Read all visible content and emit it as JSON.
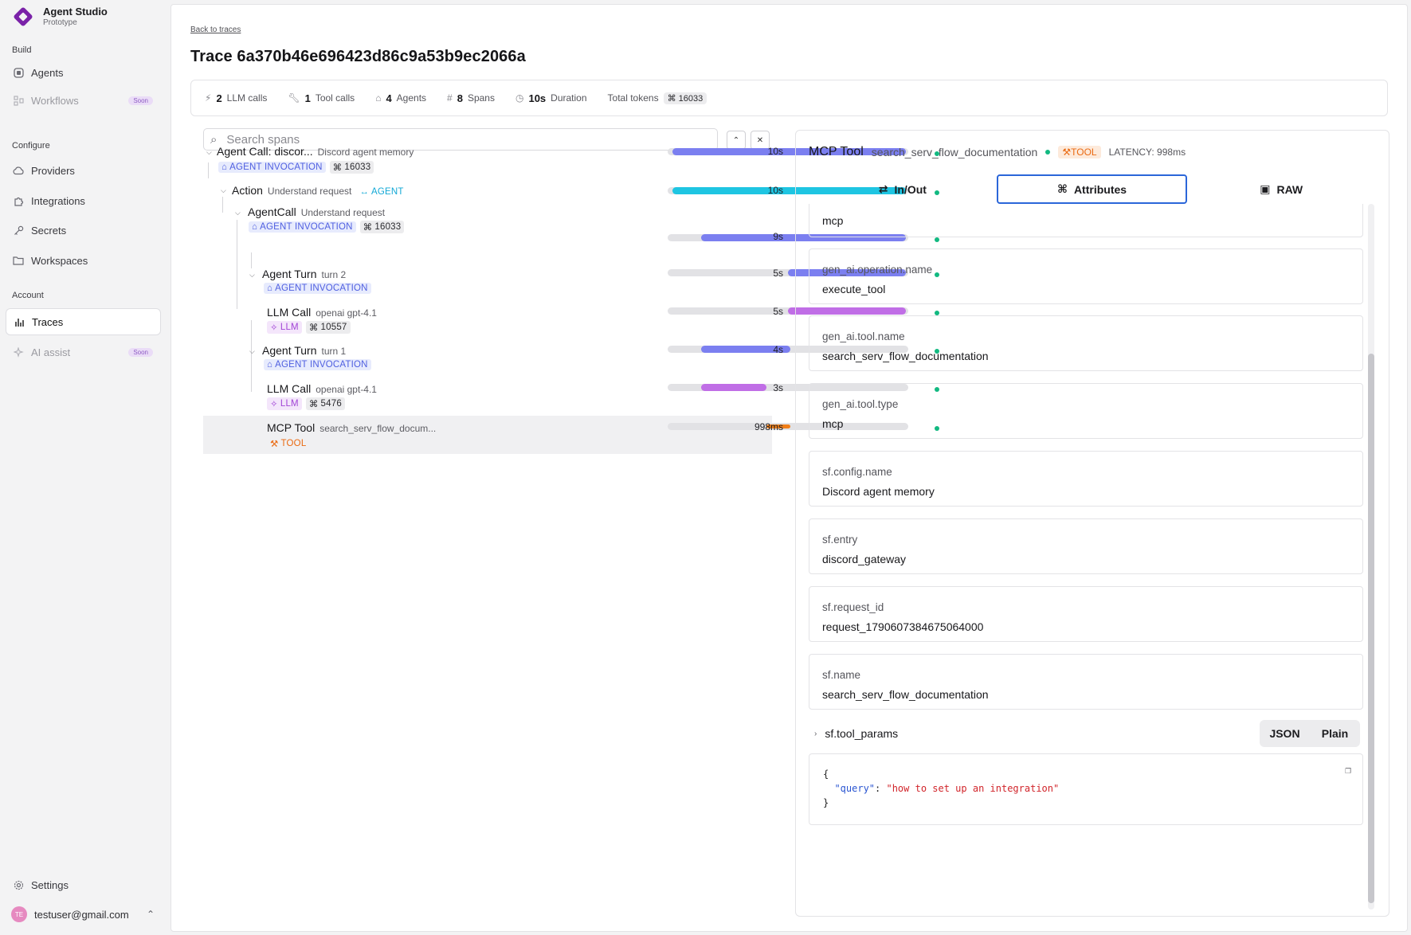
{
  "app": {
    "name": "Agent Studio",
    "subtitle": "Prototype"
  },
  "sidebar": {
    "sections": {
      "build": "Build",
      "configure": "Configure",
      "account": "Account"
    },
    "items": [
      {
        "label": "Agents",
        "icon": "agents-icon"
      },
      {
        "label": "Workflows",
        "icon": "workflows-icon",
        "badge": "Soon"
      },
      {
        "label": "Providers",
        "icon": "cloud-icon"
      },
      {
        "label": "Integrations",
        "icon": "puzzle-icon"
      },
      {
        "label": "Secrets",
        "icon": "key-icon"
      },
      {
        "label": "Workspaces",
        "icon": "folder-icon"
      },
      {
        "label": "Traces",
        "icon": "bar-chart-icon"
      },
      {
        "label": "AI assist",
        "icon": "sparkle-icon",
        "badge": "Soon"
      }
    ],
    "settings": "Settings",
    "user": {
      "initials": "TE",
      "email": "testuser@gmail.com"
    }
  },
  "header": {
    "back": "Back to traces",
    "title": "Trace 6a370b46e696423d86c9a53b9ec2066a"
  },
  "stats": {
    "llm_calls": {
      "value": "2",
      "label": "LLM calls"
    },
    "tool_calls": {
      "value": "1",
      "label": "Tool calls"
    },
    "agents": {
      "value": "4",
      "label": "Agents"
    },
    "spans": {
      "value": "8",
      "label": "Spans"
    },
    "duration": {
      "value": "10s",
      "label": "Duration"
    },
    "total_tokens": {
      "label": "Total tokens",
      "value": "16033"
    }
  },
  "search": {
    "placeholder": "Search spans"
  },
  "spans": [
    {
      "name": "Agent Call: discor...",
      "sub": "Discord agent memory",
      "badge": "AGENT INVOCATION",
      "tokens": "16033",
      "duration": "10s",
      "bar_start": 0.02,
      "bar_end": 0.99
    },
    {
      "name": "Action",
      "sub": "Understand request",
      "badge": "AGENT",
      "duration": "10s",
      "bar_start": 0.02,
      "bar_end": 0.99
    },
    {
      "name": "AgentCall",
      "sub": "Understand request",
      "badge": "AGENT INVOCATION",
      "tokens": "16033",
      "duration": "9s",
      "bar_start": 0.14,
      "bar_end": 0.99
    },
    {
      "name": "Agent Turn",
      "sub": "turn 2",
      "badge": "AGENT INVOCATION",
      "duration": "5s",
      "bar_start": 0.5,
      "bar_end": 0.99
    },
    {
      "name": "LLM Call",
      "sub": "openai gpt-4.1",
      "badge": "LLM",
      "tokens": "10557",
      "duration": "5s",
      "bar_start": 0.5,
      "bar_end": 0.99
    },
    {
      "name": "Agent Turn",
      "sub": "turn 1",
      "badge": "AGENT INVOCATION",
      "duration": "4s",
      "bar_start": 0.14,
      "bar_end": 0.51
    },
    {
      "name": "LLM Call",
      "sub": "openai gpt-4.1",
      "badge": "LLM",
      "tokens": "5476",
      "duration": "3s",
      "bar_start": 0.14,
      "bar_end": 0.41
    },
    {
      "name": "MCP Tool",
      "sub": "search_serv_flow_docum...",
      "badge": "TOOL",
      "duration": "998ms",
      "bar_start": 0.41,
      "bar_end": 0.51
    }
  ],
  "detail": {
    "title": "MCP Tool",
    "subtitle": "search_serv_flow_documentation",
    "kind": "TOOL",
    "latency": "LATENCY: 998ms",
    "tabs": [
      "In/Out",
      "Attributes",
      "RAW"
    ],
    "active_tab": "Attributes",
    "partial_top_value": "mcp",
    "attributes": [
      {
        "key": "gen_ai.operation.name",
        "value": "execute_tool"
      },
      {
        "key": "gen_ai.tool.name",
        "value": "search_serv_flow_documentation"
      },
      {
        "key": "gen_ai.tool.type",
        "value": "mcp"
      },
      {
        "key": "sf.config.name",
        "value": "Discord agent memory"
      },
      {
        "key": "sf.entry",
        "value": "discord_gateway"
      },
      {
        "key": "sf.request_id",
        "value": "request_1790607384675064000"
      },
      {
        "key": "sf.name",
        "value": "search_serv_flow_documentation"
      }
    ],
    "params": {
      "key": "sf.tool_params",
      "formats": [
        "JSON",
        "Plain"
      ],
      "json_key": "\"query\"",
      "json_value": "\"how to set up an integration\""
    }
  },
  "colors": {
    "agent_invocation": "#7b7ff0",
    "agent": "#1ec5e2",
    "llm": "#c06ee6",
    "tool": "#f07f19",
    "status_ok": "#12b981",
    "active_tab_border": "#2b66d9"
  }
}
